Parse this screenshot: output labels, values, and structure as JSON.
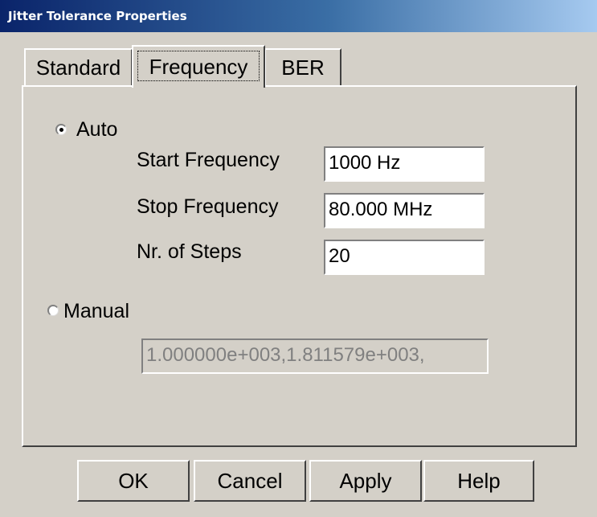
{
  "window": {
    "title": "Jitter Tolerance Properties"
  },
  "tabs": [
    {
      "label": "Standard",
      "selected": false
    },
    {
      "label": "Frequency",
      "selected": true
    },
    {
      "label": "BER",
      "selected": false
    }
  ],
  "auto": {
    "label": "Auto",
    "checked": true,
    "fields": [
      {
        "label": "Start Frequency",
        "value": "1000 Hz"
      },
      {
        "label": "Stop Frequency",
        "value": "80.000 MHz"
      },
      {
        "label": "Nr. of Steps",
        "value": "20"
      }
    ]
  },
  "manual": {
    "label": "Manual",
    "checked": false,
    "value": "1.000000e+003,1.811579e+003,",
    "disabled": true
  },
  "buttons": {
    "ok": "OK",
    "cancel": "Cancel",
    "apply": "Apply",
    "help": "Help"
  }
}
